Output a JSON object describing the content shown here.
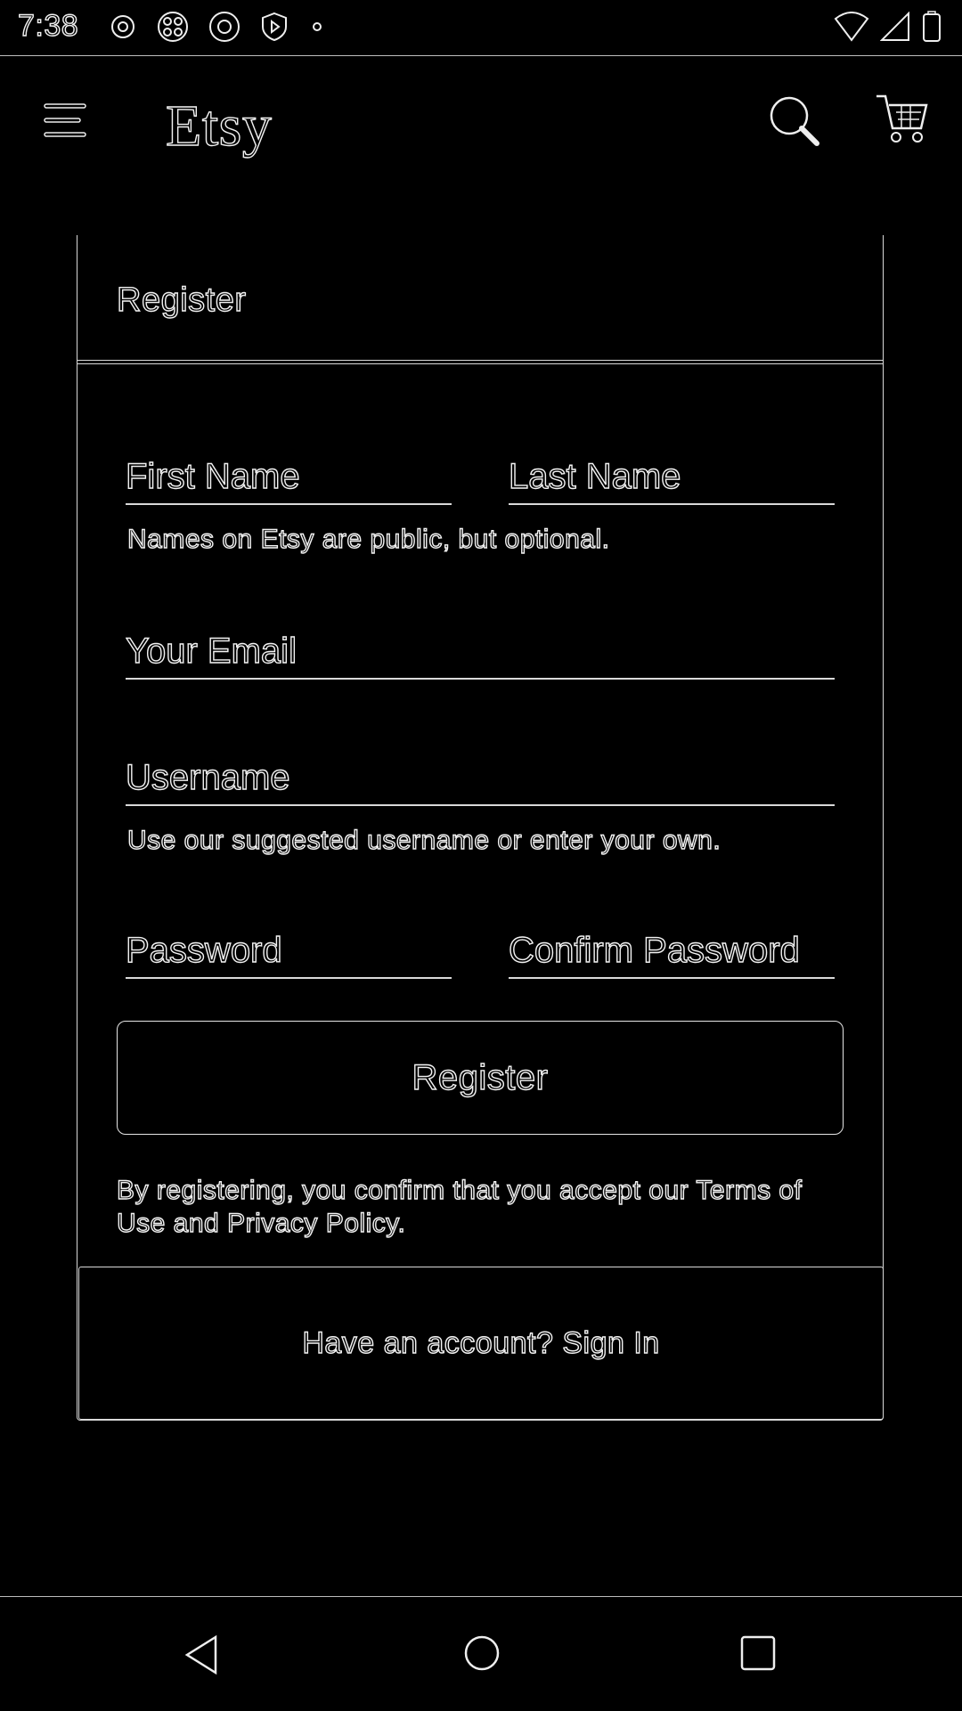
{
  "status_bar": {
    "time": "7:38",
    "icons_left": [
      "settings-icon",
      "apps-icon",
      "aperture-icon",
      "shield-play-icon",
      "dot-icon"
    ],
    "icons_right": [
      "wifi-icon",
      "signal-icon",
      "battery-icon"
    ]
  },
  "app_bar": {
    "logo": "Etsy",
    "icons": [
      "menu-icon",
      "search-icon",
      "cart-icon"
    ]
  },
  "card": {
    "header_title": "Register",
    "fields": {
      "first_name_placeholder": "First Name",
      "last_name_placeholder": "Last Name",
      "names_hint": "Names on Etsy are public, but optional.",
      "email_placeholder": "Your Email",
      "username_placeholder": "Username",
      "username_hint": "Use our suggested username or enter your own.",
      "password_placeholder": "Password",
      "confirm_password_placeholder": "Confirm Password"
    },
    "register_button": "Register",
    "legal_text": "By registering, you confirm that you accept our Terms of Use and Privacy Policy.",
    "signin_text": "Have an account? Sign In"
  },
  "nav_bar": {
    "icons": [
      "back-icon",
      "home-icon",
      "recents-icon"
    ]
  },
  "colors": {
    "background": "#000000",
    "outline": "#f2f2f2"
  }
}
